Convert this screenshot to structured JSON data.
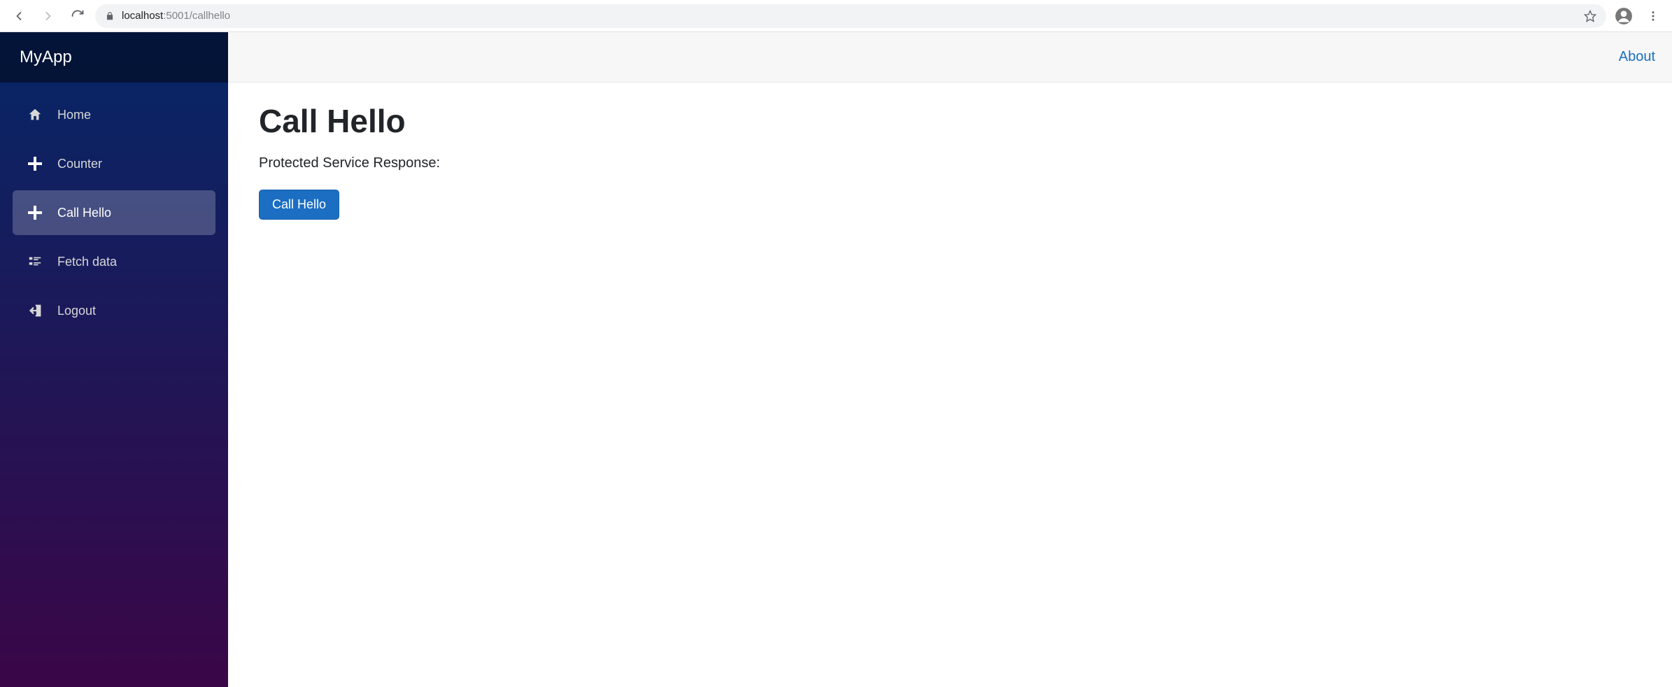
{
  "browser": {
    "url_host": "localhost",
    "url_port_path": ":5001/callhello"
  },
  "brand": "MyApp",
  "sidebar": {
    "items": [
      {
        "label": "Home"
      },
      {
        "label": "Counter"
      },
      {
        "label": "Call Hello"
      },
      {
        "label": "Fetch data"
      },
      {
        "label": "Logout"
      }
    ]
  },
  "header": {
    "about_label": "About"
  },
  "page": {
    "title": "Call Hello",
    "response_label": "Protected Service Response:",
    "button_label": "Call Hello"
  }
}
